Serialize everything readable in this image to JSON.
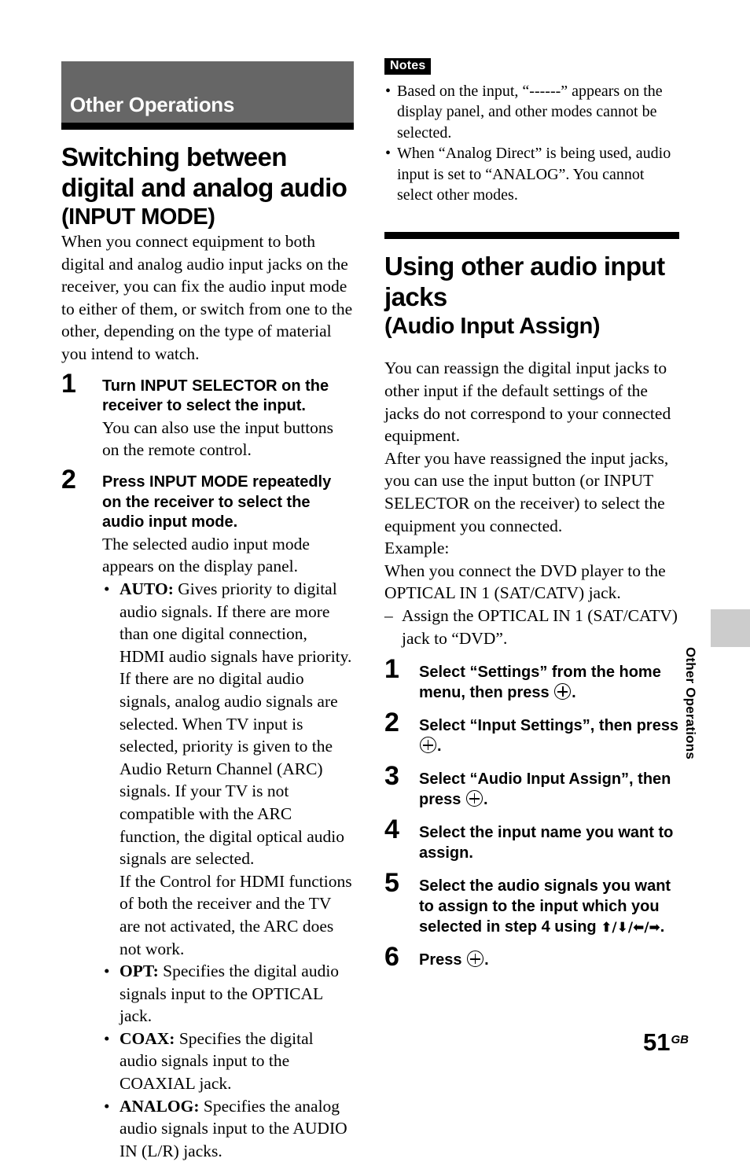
{
  "chapter": {
    "band_label": "Other Operations",
    "side_tab_label": "Other Operations"
  },
  "left_column": {
    "section": {
      "title_line1": "Switching between",
      "title_line2": "digital and analog audio",
      "subtitle": "(INPUT MODE)"
    },
    "intro": "When you connect equipment to both digital and analog audio input jacks on the receiver, you can fix the audio input mode to either of them, or switch from one to the other, depending on the type of material you intend to watch.",
    "steps": [
      {
        "number": "1",
        "head": "Turn INPUT SELECTOR on the receiver to select the input.",
        "body": "You can also use the input buttons on the remote control."
      },
      {
        "number": "2",
        "head": "Press INPUT MODE repeatedly on the receiver to select the audio input mode.",
        "body": "The selected audio input mode appears on the display panel."
      }
    ],
    "modes": [
      {
        "term": "AUTO:",
        "text": " Gives priority to digital audio signals. If there are more than one digital connection, HDMI audio signals have priority.",
        "extra": [
          "If there are no digital audio signals, analog audio signals are selected. When TV input is selected, priority is given to the Audio Return Channel (ARC) signals. If your TV is not compatible with the ARC function, the digital optical audio signals are selected.",
          "If the Control for HDMI functions of both the receiver and the TV are not activated, the ARC does not work."
        ]
      },
      {
        "term": "OPT:",
        "text": " Specifies the digital audio signals input to the OPTICAL jack.",
        "extra": []
      },
      {
        "term": "COAX:",
        "text": " Specifies the digital audio signals input to the COAXIAL jack.",
        "extra": []
      },
      {
        "term": "ANALOG:",
        "text": " Specifies the analog audio signals input to the AUDIO IN (L/R) jacks.",
        "extra": []
      }
    ]
  },
  "right_column": {
    "notes": {
      "badge": "Notes",
      "items": [
        "Based on the input, “------” appears on the display panel, and other modes cannot be selected.",
        "When “Analog Direct” is being used, audio input is set to “ANALOG”. You cannot select other modes."
      ]
    },
    "section": {
      "title_line1": "Using other audio input",
      "title_line2": "jacks",
      "subtitle": "(Audio Input Assign)"
    },
    "paragraphs": [
      "You can reassign the digital input jacks to other input if the default settings of the jacks do not correspond to your connected equipment.",
      "After you have reassigned the input jacks, you can use the input button (or INPUT SELECTOR on the receiver) to select the equipment you connected.",
      "Example:",
      "When you connect the DVD player to the OPTICAL IN 1 (SAT/CATV) jack."
    ],
    "dash_item": "Assign the OPTICAL IN 1 (SAT/CATV) jack to “DVD”.",
    "steps": [
      {
        "number": "1",
        "head_before": "Select “Settings” from the home menu, then press ",
        "glyph": "enter-circle-plus",
        "head_after": "."
      },
      {
        "number": "2",
        "head_before": "Select “Input Settings”, then press ",
        "glyph": "enter-circle-plus",
        "head_after": "."
      },
      {
        "number": "3",
        "head_before": "Select “Audio Input Assign”, then press ",
        "glyph": "enter-circle-plus",
        "head_after": "."
      },
      {
        "number": "4",
        "head_before": "Select the input name you want to assign.",
        "glyph": "",
        "head_after": ""
      },
      {
        "number": "5",
        "head_before": "Select the audio signals you want to assign to the input which you selected in step 4 using ",
        "glyph": "arrows",
        "arrows": "⬆/⬇/⬅/➡",
        "head_after": "."
      },
      {
        "number": "6",
        "head_before": "Press ",
        "glyph": "enter-circle-plus",
        "head_after": "."
      }
    ]
  },
  "folio": {
    "page_number": "51",
    "suffix": "GB"
  }
}
